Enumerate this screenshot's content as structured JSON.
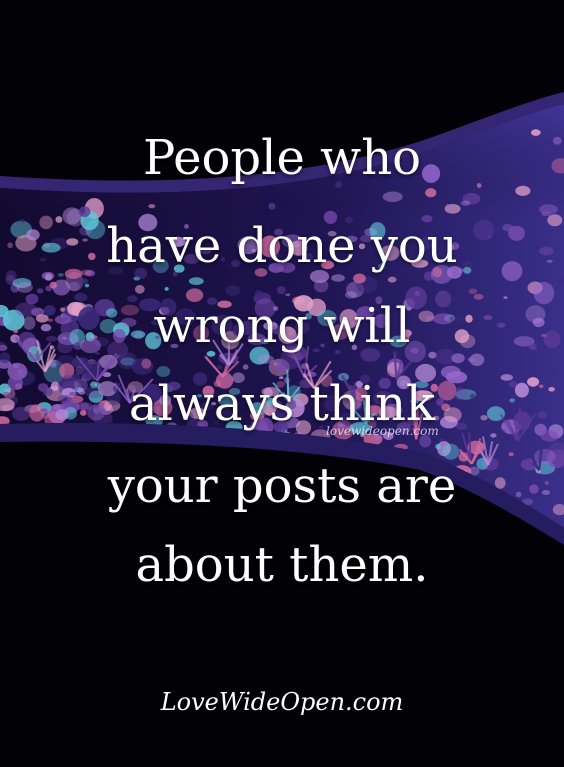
{
  "quote": {
    "lines": [
      "People who",
      "have done you",
      "wrong will",
      "always think",
      "your posts are",
      "about them."
    ]
  },
  "watermark": "lovewideopen.com",
  "brand": "LoveWideOpen.com",
  "colors": {
    "background": "#020106",
    "text": "#ffffff",
    "tank_water": "#1e1450",
    "coral_purple": "#7a4bb0",
    "coral_pink": "#d36b9e",
    "coral_cyan": "#5fc7d8"
  }
}
